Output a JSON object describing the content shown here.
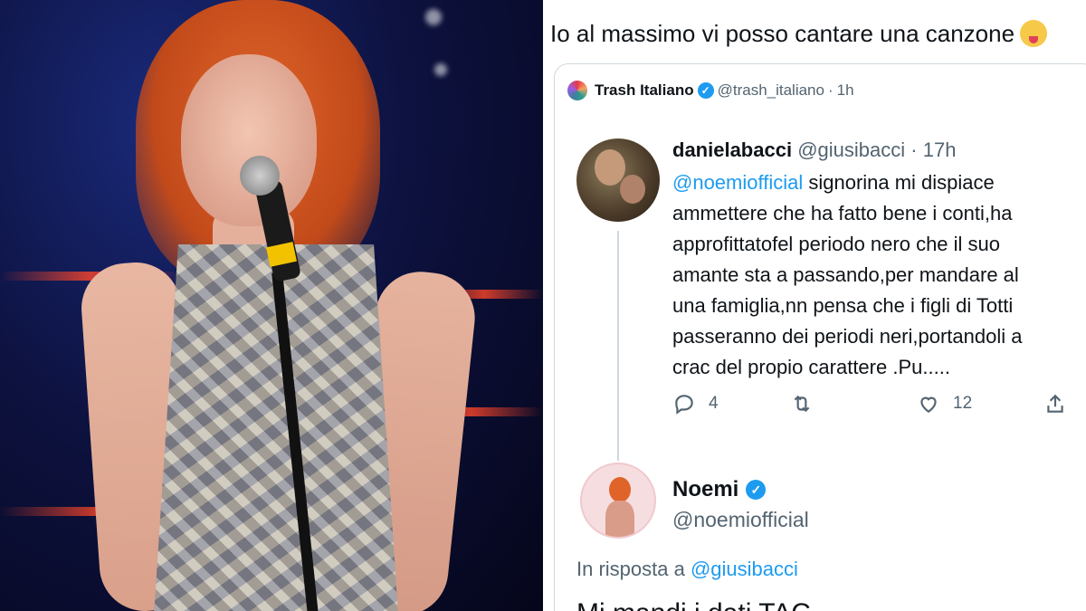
{
  "top_text": "Io al massimo vi posso cantare una canzone",
  "quoted_tweet": {
    "source_name": "Trash Italiano",
    "source_handle": "@trash_italiano",
    "source_time": "1h",
    "reply": {
      "name": "danielabacci",
      "handle": "@giusibacci",
      "time": "17h",
      "mention": "@noemiofficial",
      "lines": [
        "signorina mi dispiace",
        "ammettere che ha fatto bene i conti,ha",
        "approfittatofel periodo nero che il suo",
        "amante sta a passando,per mandare al",
        "una famiglia,nn pensa che i figli di Totti",
        "passeranno dei periodi neri,portandoli a",
        "crac del propio carattere .Pu....."
      ],
      "reply_count": "4",
      "like_count": "12"
    },
    "author": {
      "name": "Noemi",
      "handle": "@noemiofficial",
      "reply_to_prefix": "In risposta a",
      "reply_to_handle": "@giusibacci",
      "cut_off_text": "Mi mandi i dati TAC"
    }
  },
  "colors": {
    "link": "#1d9bf0",
    "muted": "#536471",
    "verified": "#1d9bf0"
  },
  "icons": [
    "wink-emoji-icon",
    "verified-icon",
    "reply-icon",
    "retweet-icon",
    "like-icon",
    "share-icon"
  ]
}
